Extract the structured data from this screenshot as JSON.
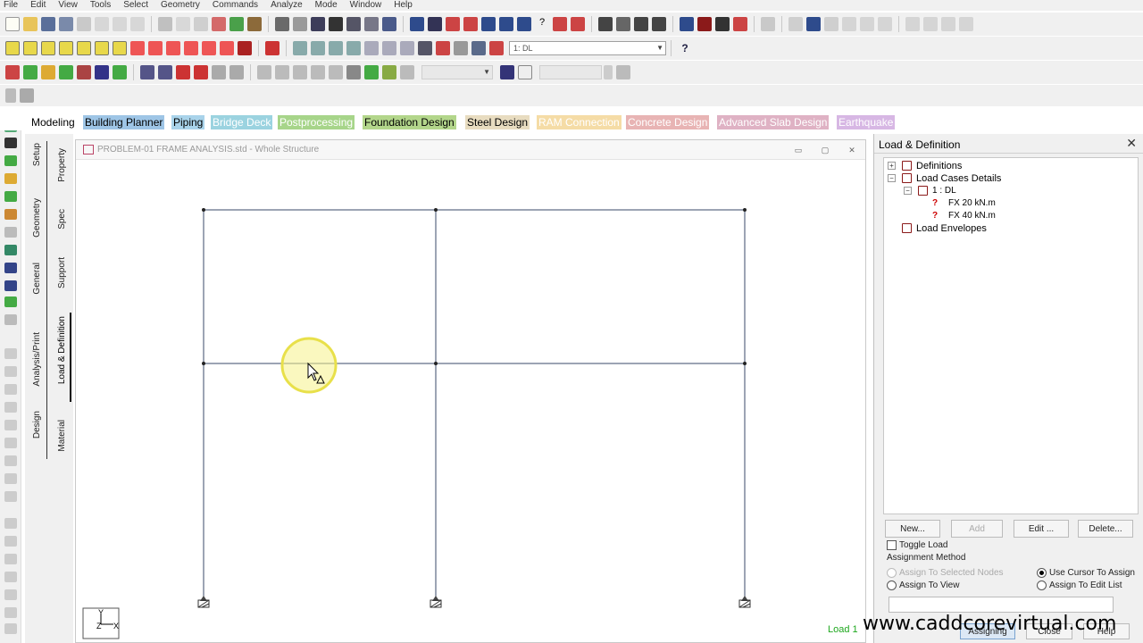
{
  "menu": [
    "File",
    "Edit",
    "View",
    "Tools",
    "Select",
    "Geometry",
    "Commands",
    "Analyze",
    "Mode",
    "Window",
    "Help"
  ],
  "toolbar": {
    "load_case_combo": "1: DL",
    "help_icon": "?"
  },
  "mode_tabs": [
    {
      "label": "Modeling",
      "bg": "#ffffff",
      "color": "#000000"
    },
    {
      "label": "Building Planner",
      "bg": "#9ec5e6",
      "color": "#000000"
    },
    {
      "label": "Piping",
      "bg": "#a9d3ea",
      "color": "#000000"
    },
    {
      "label": "Bridge Deck",
      "bg": "#9bd3e0",
      "color": "#ffffff"
    },
    {
      "label": "Postprocessing",
      "bg": "#a7d58a",
      "color": "#ffffff"
    },
    {
      "label": "Foundation Design",
      "bg": "#b3d68b",
      "color": "#000000"
    },
    {
      "label": "Steel Design",
      "bg": "#e8dcc0",
      "color": "#000000"
    },
    {
      "label": "RAM Connection",
      "bg": "#f5dca6",
      "color": "#ffffff"
    },
    {
      "label": "Concrete Design",
      "bg": "#e8b4b4",
      "color": "#ffffff"
    },
    {
      "label": "Advanced Slab Design",
      "bg": "#dfb2c4",
      "color": "#ffffff"
    },
    {
      "label": "Earthquake",
      "bg": "#d7b7e4",
      "color": "#ffffff"
    }
  ],
  "vertical_tabs": {
    "outer": [
      "Setup",
      "Geometry",
      "General",
      "Analysis/Print",
      "Design"
    ],
    "inner": [
      "Property",
      "Spec",
      "Support",
      "Load & Definition",
      "Material"
    ]
  },
  "structure_window": {
    "title": "PROBLEM-01 FRAME ANALYSIS.std - Whole Structure",
    "status_load": "Load 1",
    "axis_labels": {
      "y": "Y",
      "z": "Z",
      "x": "X"
    }
  },
  "load_panel": {
    "title": "Load & Definition",
    "tree": [
      {
        "label": "Definitions",
        "level": 0,
        "expander": "+"
      },
      {
        "label": "Load Cases Details",
        "level": 0,
        "expander": "-"
      },
      {
        "label": "1 : DL",
        "level": 1,
        "expander": "-"
      },
      {
        "label": "FX 20 kN.m",
        "level": 2
      },
      {
        "label": "FX 40 kN.m",
        "level": 2
      },
      {
        "label": "Load Envelopes",
        "level": 0
      }
    ],
    "buttons": {
      "new": "New...",
      "add": "Add",
      "edit": "Edit ...",
      "delete": "Delete..."
    },
    "toggle_load": "Toggle Load",
    "assignment_method": "Assignment Method",
    "radios": {
      "selected_nodes": "Assign To Selected Nodes",
      "cursor": "Use Cursor To Assign",
      "view": "Assign To View",
      "edit_list": "Assign To Edit List"
    },
    "bottom_buttons": {
      "assign": "Assigning",
      "close": "Close",
      "help": "Help"
    }
  },
  "watermark": "www.caddcorevirtual.com"
}
